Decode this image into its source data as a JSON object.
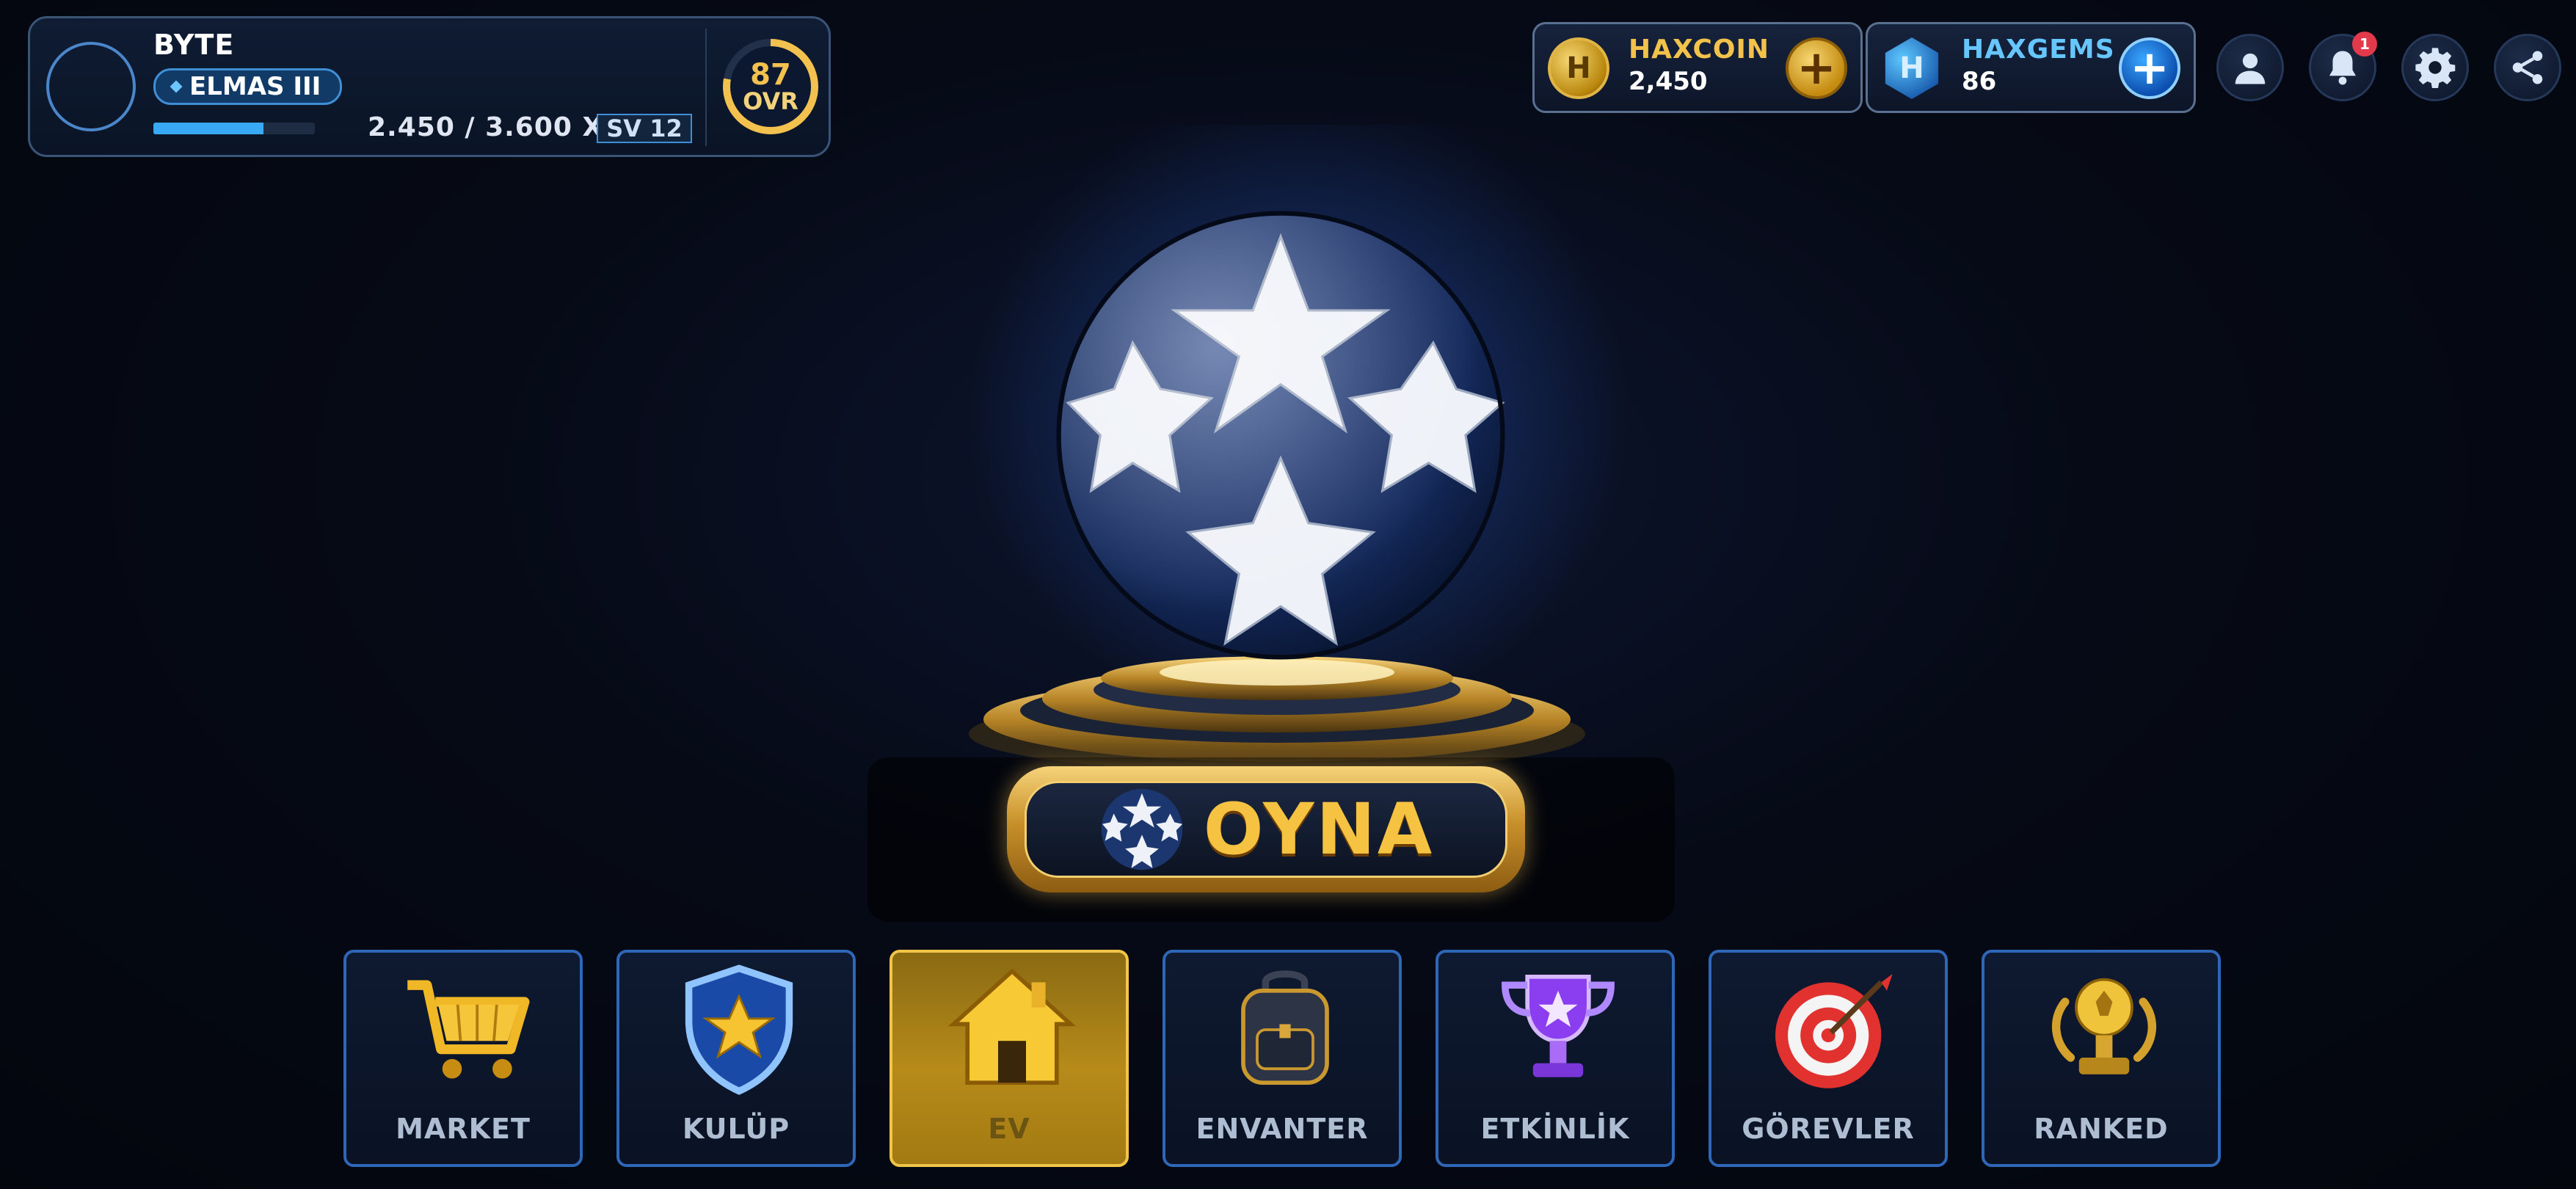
{
  "player": {
    "name": "BYTE",
    "rank": "ELMAS III",
    "xp_text": "2.450 / 3.600 XP",
    "xp_progress": 0.68,
    "level_label": "SV 12",
    "ovr_value": "87",
    "ovr_label": "OVR"
  },
  "currencies": {
    "coin": {
      "name": "HAXCOIN",
      "value": "2,450",
      "icon": "haxcoin-icon",
      "color": "#f3c24a"
    },
    "gems": {
      "name": "HAXGEMS",
      "value": "86",
      "icon": "haxgems-icon",
      "color": "#66c6ff"
    }
  },
  "top_buttons": {
    "notifications_badge": "1",
    "icons": [
      "profile-icon",
      "bell-icon",
      "gear-icon",
      "share-icon"
    ]
  },
  "play": {
    "label": "OYNA"
  },
  "nav": {
    "items": [
      {
        "label": "MARKET",
        "icon": "shopping-cart-icon"
      },
      {
        "label": "KULÜP",
        "icon": "shield-star-icon"
      },
      {
        "label": "EV",
        "icon": "house-icon",
        "active": true
      },
      {
        "label": "ENVANTER",
        "icon": "backpack-icon"
      },
      {
        "label": "ETKİNLİK",
        "icon": "trophy-icon"
      },
      {
        "label": "GÖREVLER",
        "icon": "target-icon"
      },
      {
        "label": "RANKED",
        "icon": "golden-ball-trophy-icon"
      }
    ]
  },
  "colors": {
    "accent_gold": "#f5c242",
    "accent_blue": "#2f67b8",
    "background": "#060a16"
  }
}
